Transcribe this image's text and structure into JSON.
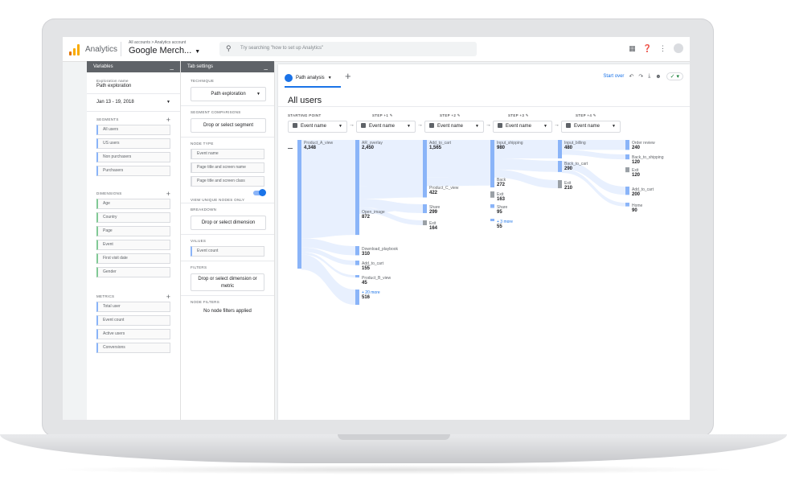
{
  "header": {
    "app_name": "Analytics",
    "breadcrumb": "All accounts > Analytics account",
    "property": "Google Merch...",
    "search_placeholder": "Try searching \"how to set up Analytics\""
  },
  "variables": {
    "title": "Variables",
    "exploration_name_label": "Exploration name",
    "exploration_name": "Path exploration",
    "date_range": "Jan 13 - 19, 2018",
    "segments_label": "SEGMENTS",
    "segments": [
      "All users",
      "US users",
      "Non purchasers",
      "Purchasers"
    ],
    "dimensions_label": "DIMENSIONS",
    "dimensions": [
      "Age",
      "Country",
      "Page",
      "Event",
      "First visit date",
      "Gender"
    ],
    "metrics_label": "METRICS",
    "metrics": [
      "Total user",
      "Event count",
      "Active users",
      "Conversions"
    ]
  },
  "tab_settings": {
    "title": "Tab settings",
    "technique_label": "TECHNIQUE",
    "technique": "Path exploration",
    "segment_comparisons_label": "SEGMENT COMPARISONS",
    "segment_drop": "Drop or select segment",
    "node_type_label": "NODE TYPE",
    "node_types": [
      "Event name",
      "Page title and screen name",
      "Page title and screen class"
    ],
    "view_unique_label": "VIEW UNIQUE NODES ONLY",
    "breakdown_label": "BREAKDOWN",
    "breakdown_drop": "Drop or select dimension",
    "values_label": "VALUES",
    "values_chip": "Event count",
    "filters_label": "FILTERS",
    "filters_drop": "Drop or select dimension or metric",
    "node_filters_label": "NODE FILTERS",
    "node_filters_text": "No node filters applied"
  },
  "main": {
    "tab_label": "Path analysis",
    "start_over": "Start over",
    "title": "All users",
    "step_labels": [
      "STARTING POINT",
      "STEP +1",
      "STEP +2",
      "STEP +3",
      "STEP +4"
    ],
    "step_dropdown": "Event name"
  },
  "nodes": {
    "s0": [
      {
        "label": "Product_A_view",
        "value": "4,348",
        "count": 4348
      }
    ],
    "s1": [
      {
        "label": "AR_overlay",
        "value": "2,450",
        "count": 2450
      },
      {
        "label": "Open_image",
        "value": "872",
        "count": 872
      },
      {
        "label": "Download_playbook",
        "value": "310",
        "count": 310
      },
      {
        "label": "Add_to_cart",
        "value": "155",
        "count": 155
      },
      {
        "label": "Product_B_view",
        "value": "45",
        "count": 45
      },
      {
        "label": "+ 20 more",
        "value": "516",
        "count": 516
      }
    ],
    "s2": [
      {
        "label": "Add_to_cart",
        "value": "1,565",
        "count": 1565
      },
      {
        "label": "Product_C_view",
        "value": "422",
        "count": 422
      },
      {
        "label": "Share",
        "value": "299",
        "count": 299
      },
      {
        "label": "Exit",
        "value": "164",
        "count": 164
      }
    ],
    "s3": [
      {
        "label": "Input_shipping",
        "value": "980",
        "count": 980
      },
      {
        "label": "Back",
        "value": "272",
        "count": 272
      },
      {
        "label": "Exit",
        "value": "163",
        "count": 163
      },
      {
        "label": "Share",
        "value": "95",
        "count": 95
      },
      {
        "label": "+ 3 more",
        "value": "55",
        "count": 55
      }
    ],
    "s4": [
      {
        "label": "Input_billing",
        "value": "480",
        "count": 480
      },
      {
        "label": "Back_to_cart",
        "value": "290",
        "count": 290
      },
      {
        "label": "Exit",
        "value": "210",
        "count": 210
      }
    ],
    "s5": [
      {
        "label": "Order review",
        "value": "240",
        "count": 240
      },
      {
        "label": "Back_to_shipping",
        "value": "120",
        "count": 120
      },
      {
        "label": "Exit",
        "value": "120",
        "count": 120
      },
      {
        "label": "Add_to_cart",
        "value": "200",
        "count": 200
      },
      {
        "label": "Home",
        "value": "90",
        "count": 90
      }
    ]
  },
  "colors": {
    "node": "#8ab4f8",
    "link": "#e8f0fe",
    "exit": "#9aa0a6",
    "accent": "#1a73e8"
  }
}
